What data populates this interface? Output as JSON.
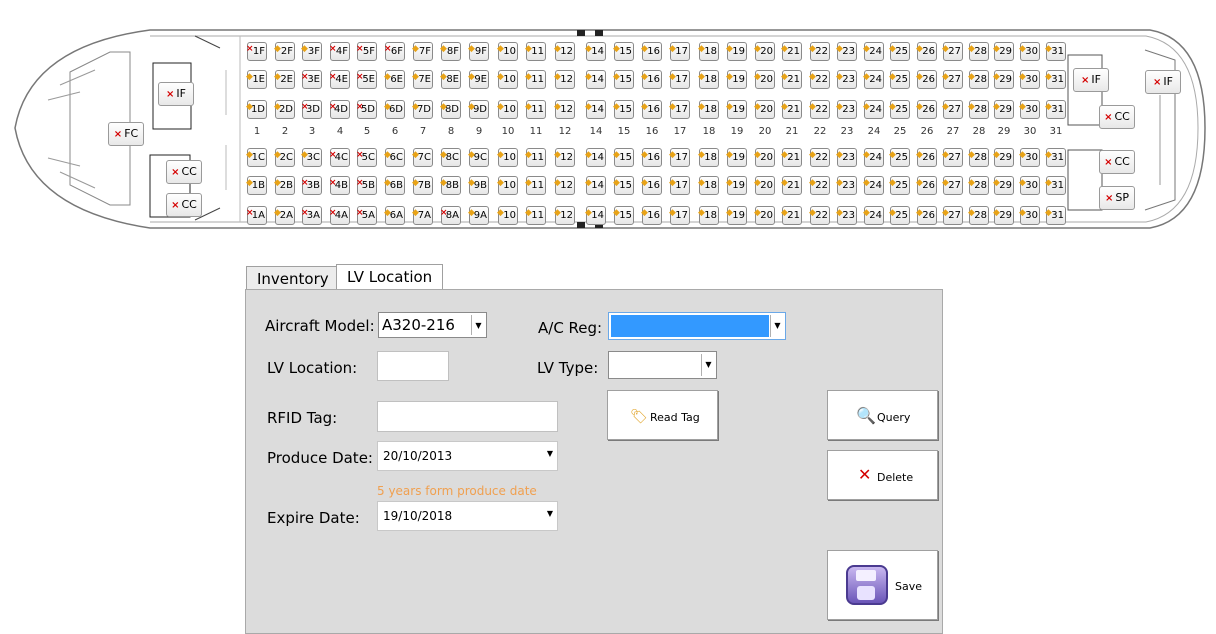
{
  "seatmap": {
    "columns": [
      "1",
      "2",
      "3",
      "4",
      "5",
      "6",
      "7",
      "8",
      "9",
      "10",
      "11",
      "12",
      "14",
      "15",
      "16",
      "17",
      "18",
      "19",
      "20",
      "21",
      "22",
      "23",
      "24",
      "25",
      "26",
      "27",
      "28",
      "29",
      "30",
      "31"
    ],
    "rows": [
      {
        "letter": "F",
        "marks": "xooxxxooooooooooooooooooooooooo"
      },
      {
        "letter": "E",
        "marks": "ooxxxoooooooooooooooooooooooooo"
      },
      {
        "letter": "D",
        "marks": "ooxxxoooooooooooooooooooooooooo"
      },
      {
        "letter": "C",
        "marks": "oooxxoooooooooooooooooooooooooo"
      },
      {
        "letter": "B",
        "marks": "ooxxxoooooooooooooooooooooooooo"
      },
      {
        "letter": "A",
        "marks": "xoxxxooxooooooooooooooooooooooo"
      }
    ],
    "stations": [
      {
        "id": "station-if-front",
        "label": "IF"
      },
      {
        "id": "station-fc",
        "label": "FC"
      },
      {
        "id": "station-cc-front-upper",
        "label": "CC"
      },
      {
        "id": "station-cc-front-lower",
        "label": "CC"
      },
      {
        "id": "station-if-rear-inner",
        "label": "IF"
      },
      {
        "id": "station-if-rear-outer",
        "label": "IF"
      },
      {
        "id": "station-cc-rear-upper",
        "label": "CC"
      },
      {
        "id": "station-cc-rear-lower",
        "label": "CC"
      },
      {
        "id": "station-sp",
        "label": "SP"
      }
    ]
  },
  "tabs": {
    "inventory": "Inventory",
    "lv_location": "LV Location"
  },
  "form": {
    "aircraft_model_label": "Aircraft Model:",
    "aircraft_model_value": "A320-216",
    "ac_reg_label": "A/C Reg:",
    "lv_location_label": "LV Location:",
    "lv_type_label": "LV Type:",
    "rfid_tag_label": "RFID Tag:",
    "produce_date_label": "Produce Date:",
    "produce_date_value": "20/10/2013",
    "note": "5 years form produce date",
    "expire_date_label": "Expire Date:",
    "expire_date_value": "19/10/2018"
  },
  "buttons": {
    "read_tag": "Read Tag",
    "query": "Query",
    "delete": "Delete",
    "save": "Save"
  },
  "colors": {
    "selection": "#3399ff",
    "note": "#f0a050",
    "ok_marker": "#e8a317",
    "bad_marker": "#d40000"
  }
}
